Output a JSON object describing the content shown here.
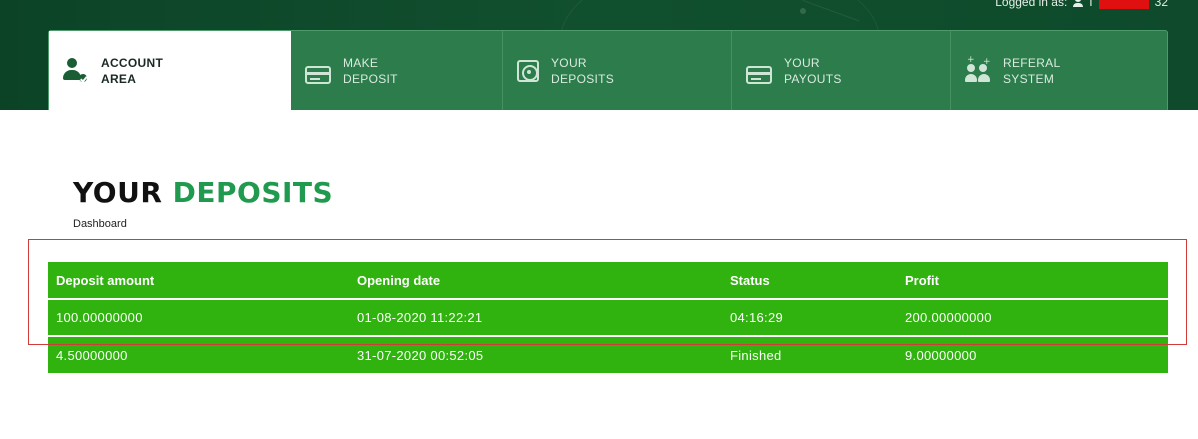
{
  "header": {
    "logged_in_label": "Logged in as:",
    "username_tail": "32"
  },
  "tabs": [
    {
      "line1": "ACCOUNT",
      "line2": "AREA",
      "icon": "account-check-icon",
      "active": true
    },
    {
      "line1": "MAKE",
      "line2": "DEPOSIT",
      "icon": "card-icon",
      "active": false
    },
    {
      "line1": "YOUR",
      "line2": "DEPOSITS",
      "icon": "safe-icon",
      "active": false
    },
    {
      "line1": "YOUR",
      "line2": "PAYOUTS",
      "icon": "card-icon",
      "active": false
    },
    {
      "line1": "REFERAL",
      "line2": "SYSTEM",
      "icon": "people-icon",
      "active": false
    }
  ],
  "page": {
    "title_part1": "YOUR",
    "title_part2": "DEPOSITS",
    "breadcrumb": "Dashboard"
  },
  "deposits_table": {
    "columns": [
      "Deposit amount",
      "Opening date",
      "Status",
      "Profit"
    ],
    "rows": [
      [
        "100.00000000",
        "01-08-2020 11:22:21",
        "04:16:29",
        "200.00000000"
      ],
      [
        "4.50000000",
        "31-07-2020 00:52:05",
        "Finished",
        "9.00000000"
      ]
    ]
  },
  "colors": {
    "header_bg": "#0f4a2b",
    "tab_bar_bg": "#2c7c4c",
    "table_bg": "#30b20f",
    "title_accent": "#1f9a4e",
    "highlight_border": "#d33a3a",
    "redaction": "#e01010"
  }
}
